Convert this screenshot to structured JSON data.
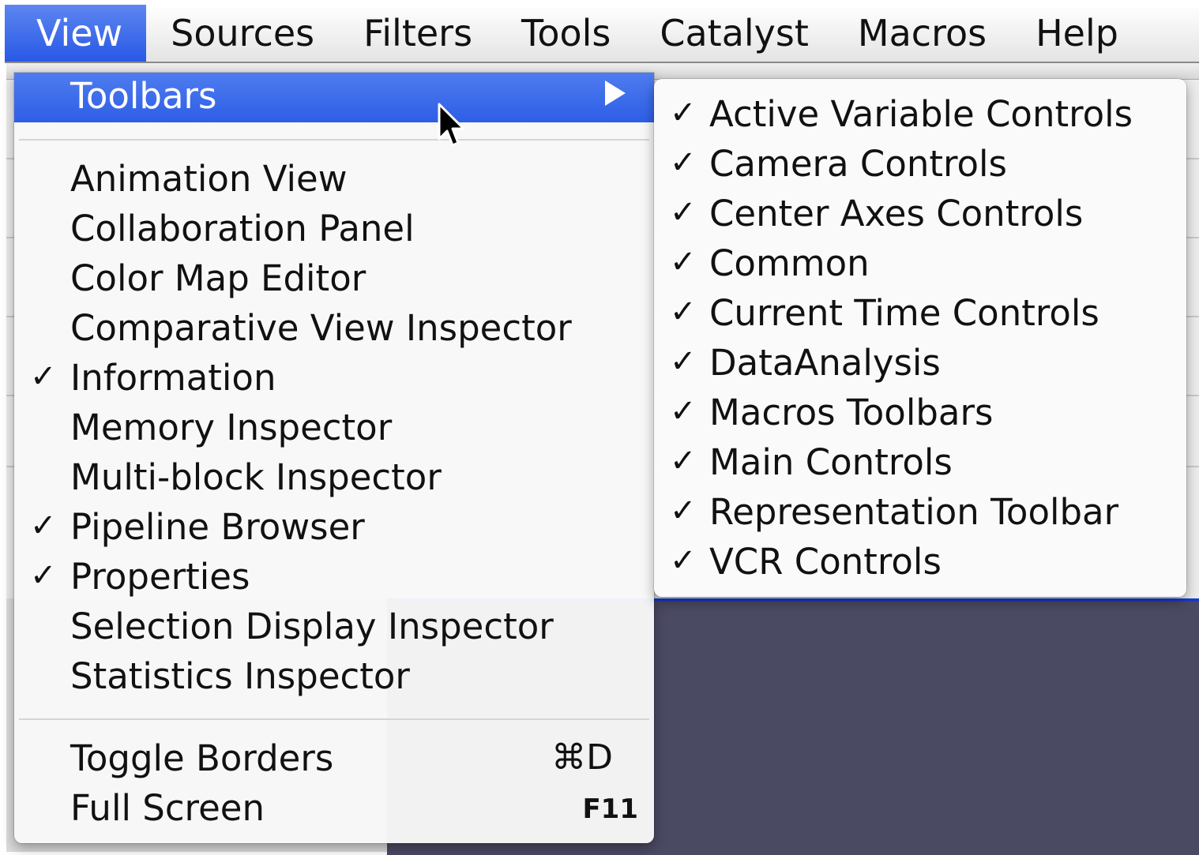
{
  "menubar": {
    "items": [
      {
        "label": "View",
        "active": true
      },
      {
        "label": "Sources",
        "active": false
      },
      {
        "label": "Filters",
        "active": false
      },
      {
        "label": "Tools",
        "active": false
      },
      {
        "label": "Catalyst",
        "active": false
      },
      {
        "label": "Macros",
        "active": false
      },
      {
        "label": "Help",
        "active": false
      }
    ]
  },
  "view_menu": {
    "toolbars": {
      "label": "Toolbars",
      "submenu_icon": "chevron-right-icon"
    },
    "panels": [
      {
        "label": "Animation View",
        "checked": false
      },
      {
        "label": "Collaboration Panel",
        "checked": false
      },
      {
        "label": "Color Map Editor",
        "checked": false
      },
      {
        "label": "Comparative View Inspector",
        "checked": false
      },
      {
        "label": "Information",
        "checked": true
      },
      {
        "label": "Memory Inspector",
        "checked": false
      },
      {
        "label": "Multi-block Inspector",
        "checked": false
      },
      {
        "label": "Pipeline Browser",
        "checked": true
      },
      {
        "label": "Properties",
        "checked": true
      },
      {
        "label": "Selection Display Inspector",
        "checked": false
      },
      {
        "label": "Statistics Inspector",
        "checked": false
      }
    ],
    "toggle_borders": {
      "label": "Toggle Borders",
      "shortcut": "⌘D"
    },
    "full_screen": {
      "label": "Full Screen",
      "shortcut": "F11"
    }
  },
  "toolbars_submenu": {
    "items": [
      {
        "label": "Active Variable Controls",
        "checked": true
      },
      {
        "label": "Camera Controls",
        "checked": true
      },
      {
        "label": "Center Axes Controls",
        "checked": true
      },
      {
        "label": "Common",
        "checked": true
      },
      {
        "label": "Current Time Controls",
        "checked": true
      },
      {
        "label": "DataAnalysis",
        "checked": true
      },
      {
        "label": "Macros Toolbars",
        "checked": true
      },
      {
        "label": "Main Controls",
        "checked": true
      },
      {
        "label": "Representation Toolbar",
        "checked": true
      },
      {
        "label": "VCR Controls",
        "checked": true
      }
    ]
  },
  "check_glyph": "✓",
  "colors": {
    "highlight": "#2d5ee6",
    "dark_panel": "#4b4a63",
    "accent_border": "#1a3ccc"
  }
}
